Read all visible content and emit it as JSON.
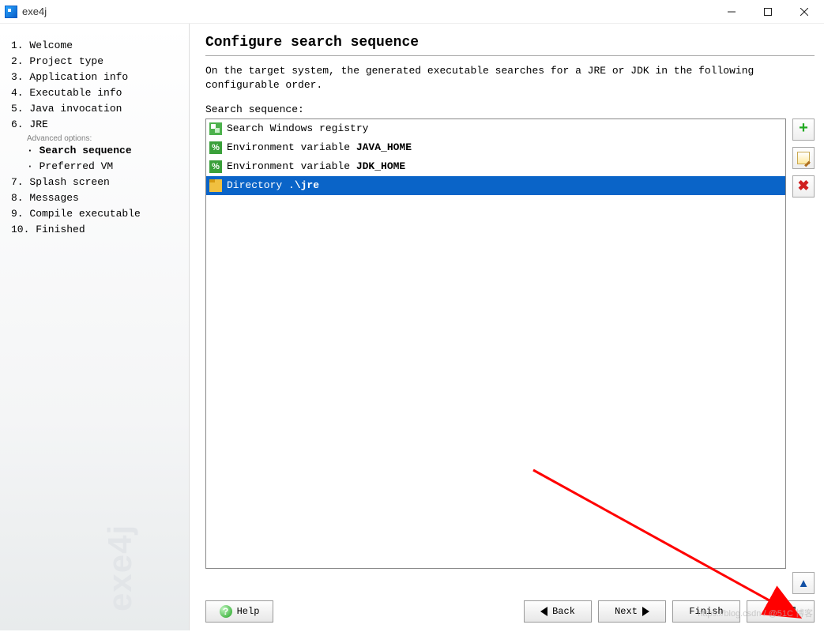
{
  "window": {
    "title": "exe4j"
  },
  "sidebar": {
    "items": [
      "1. Welcome",
      "2. Project type",
      "3. Application info",
      "4. Executable info",
      "5. Java invocation",
      "6. JRE"
    ],
    "advanced_label": "Advanced options:",
    "sub": [
      "Search sequence",
      "Preferred VM"
    ],
    "items_after": [
      "7. Splash screen",
      "8. Messages",
      "9. Compile executable",
      "10. Finished"
    ],
    "watermark": "exe4j"
  },
  "content": {
    "heading": "Configure search sequence",
    "description": "On the target system, the generated executable searches for a JRE or JDK in the following configurable order.",
    "sequence_label": "Search sequence:",
    "list": [
      {
        "icon": "reg",
        "prefix": "Search Windows registry",
        "bold": ""
      },
      {
        "icon": "env",
        "prefix": "Environment variable ",
        "bold": "JAVA_HOME"
      },
      {
        "icon": "env",
        "prefix": "Environment variable ",
        "bold": "JDK_HOME"
      },
      {
        "icon": "dir",
        "prefix": "Directory .",
        "bold": "\\jre"
      }
    ],
    "selected_index": 3
  },
  "buttons": {
    "help": "Help",
    "back": "Back",
    "next": "Next",
    "finish": "Finish",
    "cancel": "Cancel"
  },
  "watermark2": "https://blog.csdn / @51C 博客"
}
